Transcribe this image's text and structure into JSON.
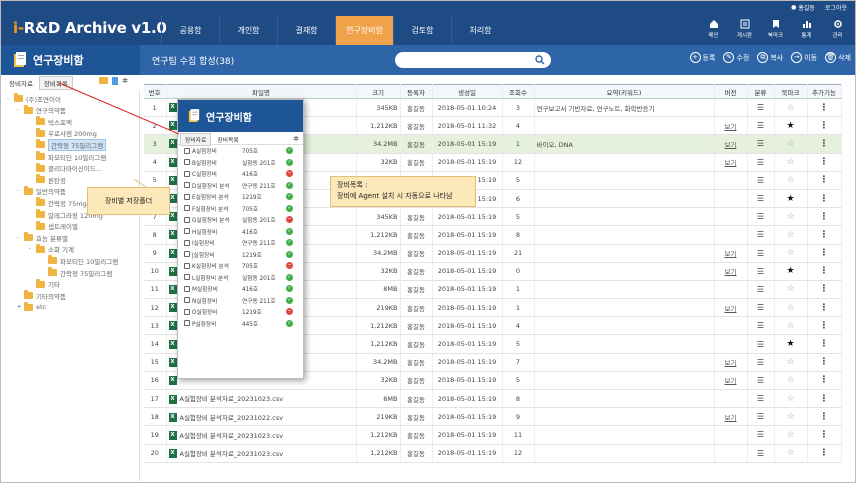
{
  "app": {
    "title_prefix": "i-",
    "title_main": "R&D Archive v1.0"
  },
  "util": {
    "user": "홍길동",
    "logout": "로그아웃"
  },
  "tabs": [
    "공용함",
    "개인함",
    "결재함",
    "연구장비함",
    "검토함",
    "처리함"
  ],
  "active_tab": 3,
  "right_nav": [
    {
      "label": "메인",
      "icon": "home-icon"
    },
    {
      "label": "게시판",
      "icon": "board-icon"
    },
    {
      "label": "북마크",
      "icon": "bookmark-icon"
    },
    {
      "label": "통계",
      "icon": "stats-icon"
    },
    {
      "label": "관리",
      "icon": "settings-icon"
    }
  ],
  "left_panel": {
    "title": "연구장비함",
    "tabs": [
      "장비자료",
      "장비목록"
    ],
    "tree": [
      {
        "label": "(주)조연이이",
        "level": 0,
        "exp": "-"
      },
      {
        "label": "연구의약품",
        "level": 1,
        "exp": "-"
      },
      {
        "label": "빅스포맥",
        "level": 2,
        "exp": ""
      },
      {
        "label": "우로샤젠 200mg",
        "level": 2,
        "exp": ""
      },
      {
        "label": "간락정 75밀리그램",
        "level": 2,
        "exp": "",
        "selected": true
      },
      {
        "label": "파모티딘 10밀리그램",
        "level": 2,
        "exp": ""
      },
      {
        "label": "클리다마이신이드…",
        "level": 2,
        "exp": ""
      },
      {
        "label": "론탄정",
        "level": 2,
        "exp": ""
      },
      {
        "label": "일반의약품",
        "level": 1,
        "exp": "-"
      },
      {
        "label": "간락정 75mg",
        "level": 2,
        "exp": ""
      },
      {
        "label": "알레그라정 120mg",
        "level": 2,
        "exp": ""
      },
      {
        "label": "셉트레이엘",
        "level": 2,
        "exp": ""
      },
      {
        "label": "효능 분류별",
        "level": 1,
        "exp": "-"
      },
      {
        "label": "소화 기계",
        "level": 2,
        "exp": "-"
      },
      {
        "label": "파모티딘 10밀리그램",
        "level": 3,
        "exp": ""
      },
      {
        "label": "간락정 75밀리그램",
        "level": 3,
        "exp": ""
      },
      {
        "label": "기타",
        "level": 2,
        "exp": ""
      },
      {
        "label": "기타의약품",
        "level": 1,
        "exp": ""
      },
      {
        "label": "etc",
        "level": 1,
        "exp": "+"
      }
    ]
  },
  "main": {
    "title": "연구팀 수집 합성(38)",
    "search_placeholder": "",
    "actions": [
      {
        "label": "등록",
        "glyph": "+"
      },
      {
        "label": "수정",
        "glyph": "✎"
      },
      {
        "label": "복사",
        "glyph": "⧉"
      },
      {
        "label": "이동",
        "glyph": "→"
      },
      {
        "label": "삭제",
        "glyph": "🗑"
      }
    ],
    "columns": [
      "번호",
      "파일명",
      "크기",
      "등록자",
      "생성일",
      "조회수",
      "요약(키워드)",
      "버전",
      "분류",
      "북마크",
      "추가기능"
    ],
    "rows": [
      {
        "no": "1",
        "name": "",
        "size": "345KB",
        "user": "홍길동",
        "date": "2018-05-01 10:24",
        "views": "3",
        "summary": "연구보고서 기반자료, 연구노트, 화학반응기",
        "ver": "",
        "cls": true,
        "bm": false
      },
      {
        "no": "2",
        "name": "",
        "size": "1,212KB",
        "user": "홍길동",
        "date": "2018-05-01 11:32",
        "views": "4",
        "summary": "",
        "ver": "보기",
        "cls": true,
        "bm": true
      },
      {
        "no": "3",
        "name": "",
        "size": "34.2MB",
        "user": "홍길동",
        "date": "2018-05-01 15:19",
        "views": "1",
        "summary": "바이오, DNA",
        "ver": "보기",
        "cls": true,
        "bm": false,
        "hl": true
      },
      {
        "no": "4",
        "name": "",
        "size": "32KB",
        "user": "홍길동",
        "date": "2018-05-01 15:19",
        "views": "12",
        "summary": "",
        "ver": "보기",
        "cls": true,
        "bm": false
      },
      {
        "no": "5",
        "name": "",
        "size": "",
        "user": "",
        "date": "2018-05-01 15:19",
        "views": "5",
        "summary": "",
        "ver": "",
        "cls": true,
        "bm": false
      },
      {
        "no": "6",
        "name": "",
        "size": "",
        "user": "",
        "date": "2018-05-01 15:19",
        "views": "6",
        "summary": "",
        "ver": "",
        "cls": true,
        "bm": true
      },
      {
        "no": "7",
        "name": "",
        "size": "345KB",
        "user": "홍길동",
        "date": "2018-05-01 15:19",
        "views": "5",
        "summary": "",
        "ver": "",
        "cls": true,
        "bm": false
      },
      {
        "no": "8",
        "name": "",
        "size": "1,212KB",
        "user": "홍길동",
        "date": "2018-05-01 15:19",
        "views": "8",
        "summary": "",
        "ver": "",
        "cls": true,
        "bm": false
      },
      {
        "no": "9",
        "name": "",
        "size": "34.2MB",
        "user": "홍길동",
        "date": "2018-05-01 15:19",
        "views": "21",
        "summary": "",
        "ver": "보기",
        "cls": true,
        "bm": false
      },
      {
        "no": "10",
        "name": "",
        "size": "32KB",
        "user": "홍길동",
        "date": "2018-05-01 15:19",
        "views": "0",
        "summary": "",
        "ver": "보기",
        "cls": true,
        "bm": true
      },
      {
        "no": "11",
        "name": "",
        "size": "8MB",
        "user": "홍길동",
        "date": "2018-05-01 15:19",
        "views": "1",
        "summary": "",
        "ver": "",
        "cls": true,
        "bm": false
      },
      {
        "no": "12",
        "name": "",
        "size": "219KB",
        "user": "홍길동",
        "date": "2018-05-01 15:19",
        "views": "1",
        "summary": "",
        "ver": "보기",
        "cls": true,
        "bm": false
      },
      {
        "no": "13",
        "name": "",
        "size": "1,212KB",
        "user": "홍길동",
        "date": "2018-05-01 15:19",
        "views": "4",
        "summary": "",
        "ver": "",
        "cls": true,
        "bm": false
      },
      {
        "no": "14",
        "name": "",
        "size": "1,212KB",
        "user": "홍길동",
        "date": "2018-05-01 15:19",
        "views": "5",
        "summary": "",
        "ver": "",
        "cls": true,
        "bm": true
      },
      {
        "no": "15",
        "name": "",
        "size": "34.2MB",
        "user": "홍길동",
        "date": "2018-05-01 15:19",
        "views": "7",
        "summary": "",
        "ver": "보기",
        "cls": true,
        "bm": false
      },
      {
        "no": "16",
        "name": "",
        "size": "32KB",
        "user": "홍길동",
        "date": "2018-05-01 15:19",
        "views": "5",
        "summary": "",
        "ver": "보기",
        "cls": true,
        "bm": false
      },
      {
        "no": "17",
        "name": "A실험장비 분석자료_20231023.csv",
        "size": "8MB",
        "user": "홍길동",
        "date": "2018-05-01 15:19",
        "views": "8",
        "summary": "",
        "ver": "",
        "cls": true,
        "bm": false
      },
      {
        "no": "18",
        "name": "A실험장비 분석자료_20231022.csv",
        "size": "219KB",
        "user": "홍길동",
        "date": "2018-05-01 15:19",
        "views": "9",
        "summary": "",
        "ver": "보기",
        "cls": true,
        "bm": false
      },
      {
        "no": "19",
        "name": "A실험장비 분석자료_20231023.csv",
        "size": "1,212KB",
        "user": "홍길동",
        "date": "2018-05-01 15:19",
        "views": "11",
        "summary": "",
        "ver": "",
        "cls": true,
        "bm": false
      },
      {
        "no": "20",
        "name": "A실험장비 분석자료_20231023.csv",
        "size": "1,212KB",
        "user": "홍길동",
        "date": "2018-05-01 15:19",
        "views": "12",
        "summary": "",
        "ver": "",
        "cls": true,
        "bm": false
      }
    ]
  },
  "popup": {
    "title": "연구장비함",
    "tabs": [
      "장비자료",
      "장비목록"
    ],
    "items": [
      {
        "name": "A실험장비",
        "loc": "705호",
        "ok": true
      },
      {
        "name": "B실험장비",
        "loc": "실험동 201호",
        "ok": true
      },
      {
        "name": "C실험장비",
        "loc": "416호",
        "ok": false
      },
      {
        "name": "D실험장비 분석",
        "loc": "연구동 211호",
        "ok": true
      },
      {
        "name": "E실험장비 분석",
        "loc": "1219호",
        "ok": true
      },
      {
        "name": "F실험장비 분석",
        "loc": "705호",
        "ok": true
      },
      {
        "name": "G실험장비 분석",
        "loc": "실험동 201호",
        "ok": false
      },
      {
        "name": "H실험장비",
        "loc": "416호",
        "ok": true
      },
      {
        "name": "I실험장비",
        "loc": "연구동 211호",
        "ok": true
      },
      {
        "name": "J실험장비",
        "loc": "1219호",
        "ok": true
      },
      {
        "name": "K실험장비 분석",
        "loc": "705호",
        "ok": false
      },
      {
        "name": "L실험장비 분석",
        "loc": "실험동 201호",
        "ok": true
      },
      {
        "name": "M실험장비",
        "loc": "416호",
        "ok": true
      },
      {
        "name": "N실험장비",
        "loc": "연구동 211호",
        "ok": true
      },
      {
        "name": "O실험장비",
        "loc": "1219호",
        "ok": false
      },
      {
        "name": "P실험장비",
        "loc": "445호",
        "ok": true
      }
    ]
  },
  "callouts": {
    "left": "장비별 저장폴더",
    "right_title": "장비목록 :",
    "right_body": "장비에 Agent 설치 시 자동으로 나타남"
  },
  "colors": {
    "header": "#1f4b84",
    "active_tab": "#f0a24a",
    "panel": "#1e5596",
    "highlight_row": "#e5f1dc",
    "ok": "#3fae49",
    "ng": "#e0483f"
  }
}
